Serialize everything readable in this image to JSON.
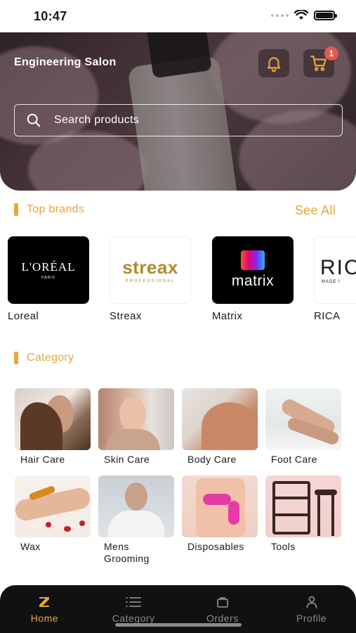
{
  "status_bar": {
    "time": "10:47"
  },
  "header": {
    "app_title": "Engineering Salon",
    "cart_badge": "1",
    "search_placeholder": "Search products"
  },
  "brands_section": {
    "title": "Top brands",
    "see_all": "See All",
    "items": [
      {
        "name": "Loreal",
        "logo_text": "L'ORÉAL",
        "logo_sub": "PARIS"
      },
      {
        "name": "Streax",
        "logo_text": "streax",
        "logo_sub": "PROFESSIONAL"
      },
      {
        "name": "Matrix",
        "logo_text": "matrix",
        "logo_sub": ""
      },
      {
        "name": "RICA",
        "logo_text": "RIC",
        "logo_sub": "MADE I"
      }
    ]
  },
  "category_section": {
    "title": "Category",
    "items": [
      {
        "name": "Hair Care"
      },
      {
        "name": "Skin Care"
      },
      {
        "name": "Body Care"
      },
      {
        "name": "Foot Care"
      },
      {
        "name": "Wax"
      },
      {
        "name": "Mens Grooming"
      },
      {
        "name": "Disposables"
      },
      {
        "name": "Tools"
      }
    ]
  },
  "bottom_nav": {
    "items": [
      {
        "label": "Home",
        "icon": "home-z-icon",
        "active": true
      },
      {
        "label": "Category",
        "icon": "list-icon",
        "active": false
      },
      {
        "label": "Orders",
        "icon": "bag-icon",
        "active": false
      },
      {
        "label": "Profile",
        "icon": "person-icon",
        "active": false
      }
    ]
  },
  "colors": {
    "accent": "#e9a63a",
    "badge": "#e05a4f",
    "nav_bg": "#111111"
  }
}
